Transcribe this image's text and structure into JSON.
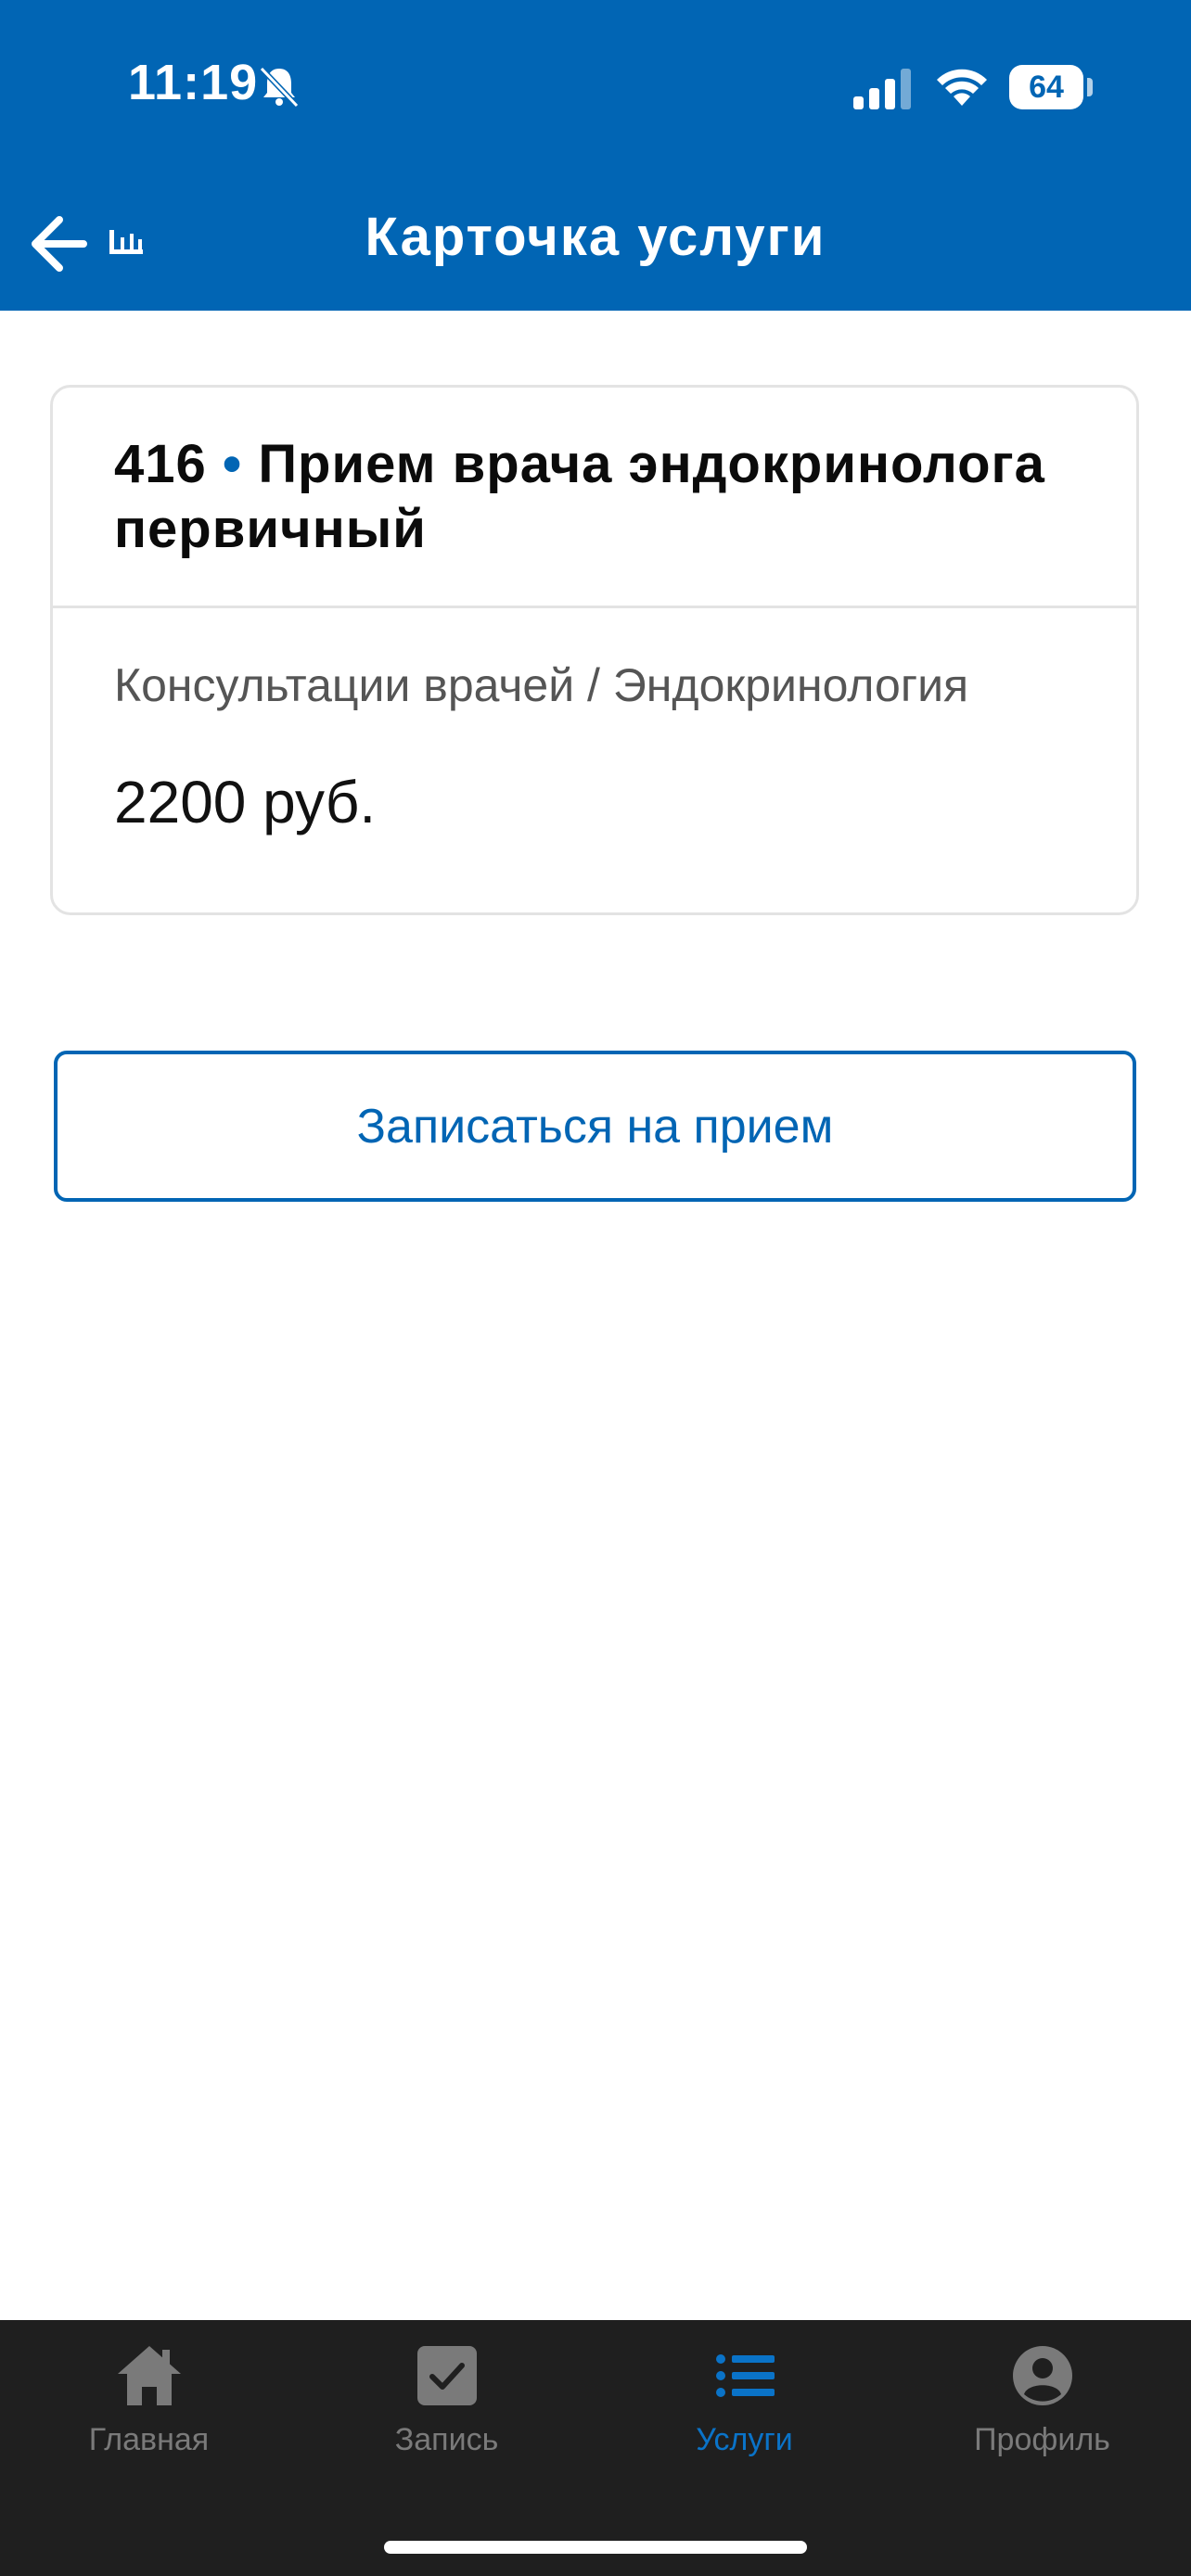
{
  "status_bar": {
    "time": "11:19",
    "battery": "64"
  },
  "header": {
    "title": "Карточка услуги"
  },
  "service": {
    "code": "416",
    "separator": " • ",
    "name": "Прием врача эндокринолога первичный",
    "category": "Консультации врачей / Эндокринология",
    "price": "2200 руб."
  },
  "actions": {
    "book_label": "Записаться на прием"
  },
  "tabbar": {
    "items": [
      {
        "label": "Главная",
        "icon": "home-icon"
      },
      {
        "label": "Запись",
        "icon": "checkbox-icon"
      },
      {
        "label": "Услуги",
        "icon": "list-icon",
        "active": true
      },
      {
        "label": "Профиль",
        "icon": "profile-icon"
      }
    ]
  },
  "colors": {
    "brand": "#0165b4",
    "tab_active": "#0a73c8",
    "tabbar_bg": "#1f1f1f"
  }
}
